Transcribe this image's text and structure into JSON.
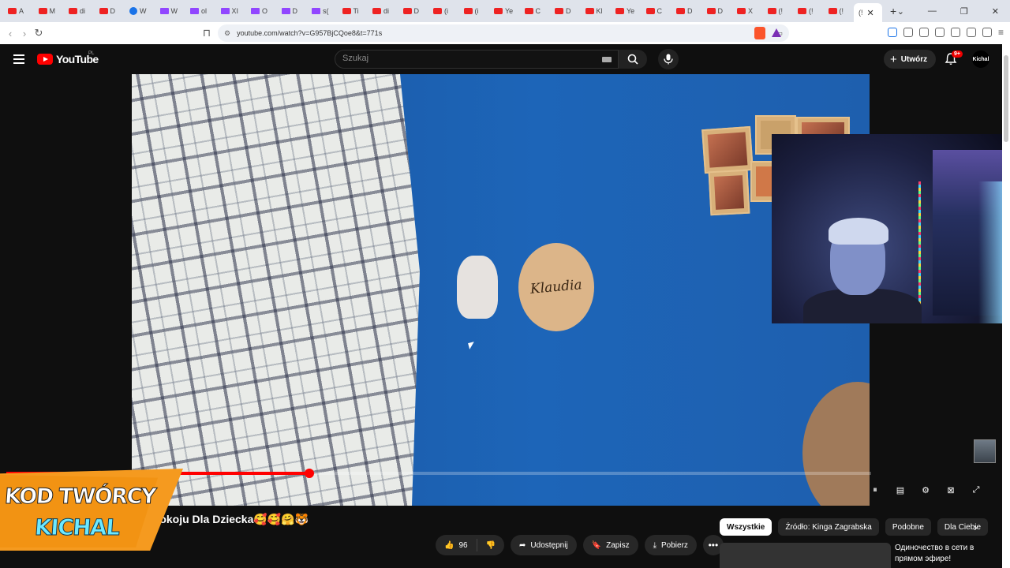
{
  "browser": {
    "tabs": [
      {
        "label": "A",
        "kind": "yt"
      },
      {
        "label": "M",
        "kind": "yt"
      },
      {
        "label": "di",
        "kind": "yt"
      },
      {
        "label": "D",
        "kind": "yt"
      },
      {
        "label": "W",
        "kind": "chrome"
      },
      {
        "label": "W",
        "kind": "tw"
      },
      {
        "label": "ol",
        "kind": "tw"
      },
      {
        "label": "XI",
        "kind": "tw"
      },
      {
        "label": "O",
        "kind": "tw"
      },
      {
        "label": "D",
        "kind": "tw"
      },
      {
        "label": "s(",
        "kind": "tw"
      },
      {
        "label": "Ti",
        "kind": "yt"
      },
      {
        "label": "di",
        "kind": "yt"
      },
      {
        "label": "D",
        "kind": "yt"
      },
      {
        "label": "(i",
        "kind": "yt"
      },
      {
        "label": "(i",
        "kind": "yt"
      },
      {
        "label": "Ye",
        "kind": "yt"
      },
      {
        "label": "C",
        "kind": "yt"
      },
      {
        "label": "D",
        "kind": "yt"
      },
      {
        "label": "Kl",
        "kind": "yt"
      },
      {
        "label": "Ye",
        "kind": "yt"
      },
      {
        "label": "C",
        "kind": "yt"
      },
      {
        "label": "D",
        "kind": "yt"
      },
      {
        "label": "D",
        "kind": "yt"
      },
      {
        "label": "X",
        "kind": "yt"
      },
      {
        "label": "(!",
        "kind": "yt"
      },
      {
        "label": "(!",
        "kind": "yt"
      },
      {
        "label": "(!",
        "kind": "yt"
      }
    ],
    "active_tab_label": "(!",
    "url": "youtube.com/watch?v=G957BjCQoe8&t=771s",
    "new_tab": "+",
    "close_tab": "✕"
  },
  "youtube": {
    "logo_text": "YouTube",
    "logo_country": "PL",
    "search_placeholder": "Szukaj",
    "create_label": "Utwórz",
    "notif_count": "9+",
    "avatar_text": "Kichal"
  },
  "video": {
    "sign_text": "Klaudia",
    "progress_fraction": 0.35,
    "title": "Pokoju Dla Dziecka🥰🥰🤗🐯"
  },
  "actions": {
    "likes": "96",
    "share": "Udostępnij",
    "save": "Zapisz",
    "download": "Pobierz",
    "more": "•••"
  },
  "chips": [
    "Wszystkie",
    "Źródło: Kinga Zagrabska",
    "Podobne",
    "Dla Ciebie"
  ],
  "recommendation": {
    "title": "Одиночество в сети в прямом эфире!"
  },
  "creator_code": {
    "line1": "KOD TWÓRCY",
    "line2": "KICHAL"
  },
  "colors": {
    "yt_red": "#ff0000",
    "bg": "#0f0f0f",
    "overlay_orange": "#f59a1f",
    "overlay_cyan": "#6de9ff"
  }
}
